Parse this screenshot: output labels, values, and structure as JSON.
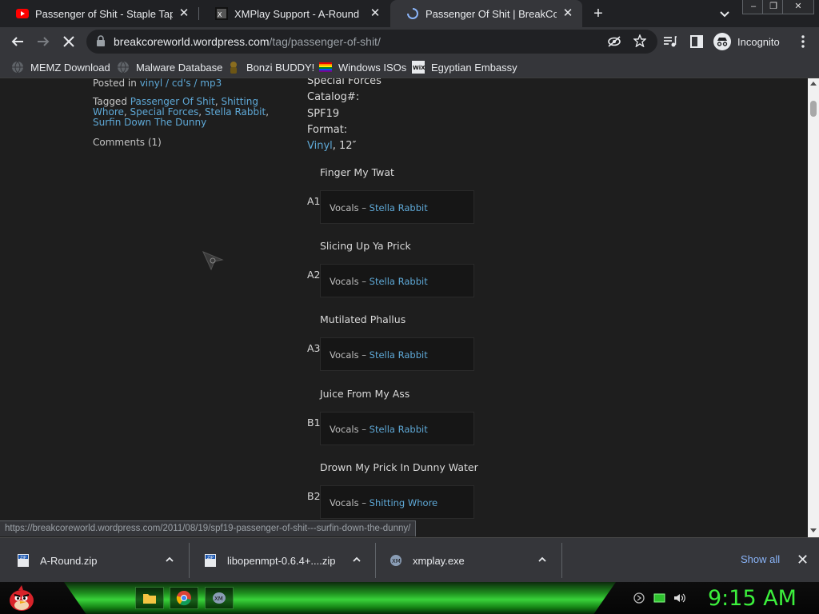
{
  "tabs": [
    {
      "title": "Passenger of Shit - Staple Tapew",
      "favicon": "youtube-icon"
    },
    {
      "title": "XMPlay Support - A-Round",
      "favicon": "xmplay-icon"
    },
    {
      "title": "Passenger Of Shit | BreakCoreWo",
      "favicon": "loading-icon"
    }
  ],
  "window_controls": {
    "minimize": "–",
    "restore": "❐",
    "close": "✕"
  },
  "toolbar": {
    "url_host": "breakcoreworld.wordpress.com",
    "url_path": "/tag/passenger-of-shit/",
    "incognito_label": "Incognito"
  },
  "bookmarks": [
    {
      "label": "MEMZ Download",
      "icon": "globe-icon"
    },
    {
      "label": "Malware Database",
      "icon": "globe-icon"
    },
    {
      "label": "Bonzi BUDDY!",
      "icon": "bonzi-icon"
    },
    {
      "label": "Windows ISOs",
      "icon": "rainbow-flag-icon"
    },
    {
      "label": "Egyptian Embassy",
      "icon": "wix-icon"
    }
  ],
  "page": {
    "posted_in_prefix": "Posted in",
    "posted_in_link": "vinyl / cd's / mp3",
    "tagged_prefix": "Tagged",
    "tags": [
      "Passenger Of Shit",
      "Shitting Whore",
      "Special Forces",
      "Stella Rabbit",
      "Surfin Down The Dunny"
    ],
    "comments": "Comments (1)",
    "label_top": "Special Forces",
    "catalog_label": "Catalog#:",
    "catalog_value": "SPF19",
    "format_label": "Format:",
    "format_link": "Vinyl",
    "format_rest": ", 12″",
    "vocals_label": "Vocals –",
    "tracks": [
      {
        "pos": "A1",
        "title": "Finger My Twat",
        "vocalist": "Stella Rabbit"
      },
      {
        "pos": "A2",
        "title": "Slicing Up Ya Prick",
        "vocalist": "Stella Rabbit"
      },
      {
        "pos": "A3",
        "title": "Mutilated Phallus",
        "vocalist": "Stella Rabbit"
      },
      {
        "pos": "B1",
        "title": "Juice From My Ass",
        "vocalist": "Stella Rabbit"
      },
      {
        "pos": "B2",
        "title": "Drown My Prick In Dunny Water",
        "vocalist": "Shitting Whore"
      }
    ]
  },
  "status_url": "https://breakcoreworld.wordpress.com/2011/08/19/spf19-passenger-of-shit---surfin-down-the-dunny/",
  "downloads": [
    {
      "name": "A-Round.zip"
    },
    {
      "name": "libopenmpt-0.6.4+....zip"
    },
    {
      "name": "xmplay.exe"
    }
  ],
  "show_all": "Show all",
  "clock": "9:15 AM",
  "colors": {
    "link": "#5ea8d6",
    "clock": "#3cf03c",
    "taskbar_green": "#39d23a"
  }
}
